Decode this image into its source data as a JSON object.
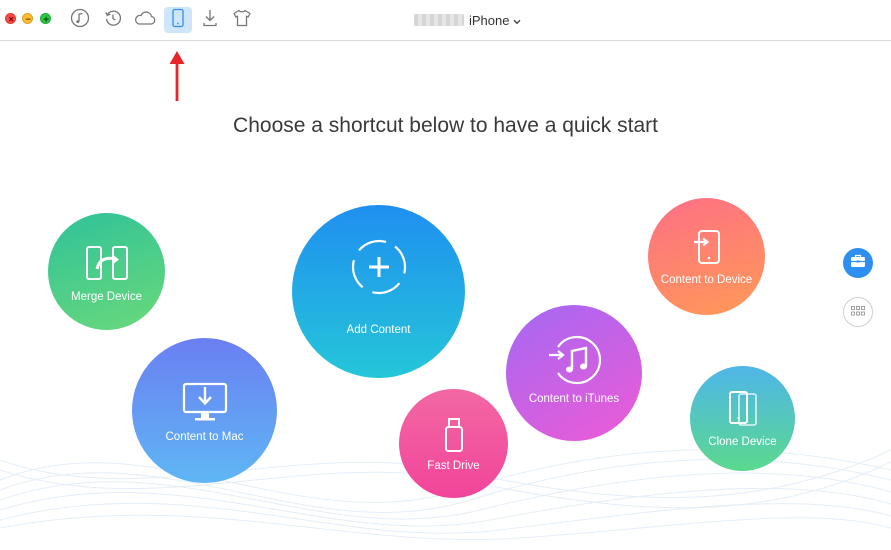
{
  "toolbar": {
    "device_name": "iPhone",
    "buttons": [
      {
        "icon": "music-icon"
      },
      {
        "icon": "restore-icon"
      },
      {
        "icon": "cloud-icon"
      },
      {
        "icon": "phone-icon",
        "active": true
      },
      {
        "icon": "download-icon"
      },
      {
        "icon": "tshirt-icon"
      }
    ]
  },
  "main": {
    "headline": "Choose a shortcut below to have a quick start",
    "shortcuts": {
      "merge_device": "Merge Device",
      "content_to_mac": "Content to Mac",
      "add_content": "Add Content",
      "fast_drive": "Fast Drive",
      "content_to_itunes": "Content to iTunes",
      "content_to_device": "Content to Device",
      "clone_device": "Clone Device"
    }
  },
  "colors": {
    "accent": "#2d8ff0",
    "annotation_arrow": "#e8262a"
  }
}
